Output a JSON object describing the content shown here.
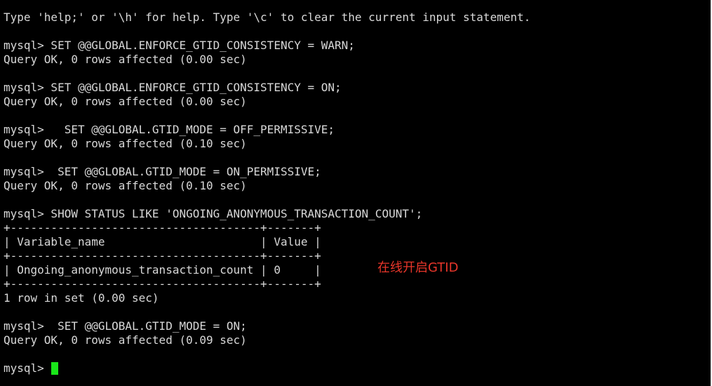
{
  "terminal": {
    "lines": [
      "Type 'help;' or '\\h' for help. Type '\\c' to clear the current input statement.",
      "",
      "mysql> SET @@GLOBAL.ENFORCE_GTID_CONSISTENCY = WARN;",
      "Query OK, 0 rows affected (0.00 sec)",
      "",
      "mysql> SET @@GLOBAL.ENFORCE_GTID_CONSISTENCY = ON;",
      "Query OK, 0 rows affected (0.00 sec)",
      "",
      "mysql>   SET @@GLOBAL.GTID_MODE = OFF_PERMISSIVE;",
      "Query OK, 0 rows affected (0.10 sec)",
      "",
      "mysql>  SET @@GLOBAL.GTID_MODE = ON_PERMISSIVE;",
      "Query OK, 0 rows affected (0.10 sec)",
      "",
      "mysql> SHOW STATUS LIKE 'ONGOING_ANONYMOUS_TRANSACTION_COUNT';",
      "+-------------------------------------+-------+",
      "| Variable_name                       | Value |",
      "+-------------------------------------+-------+",
      "| Ongoing_anonymous_transaction_count | 0     |",
      "+-------------------------------------+-------+",
      "1 row in set (0.00 sec)",
      "",
      "mysql>  SET @@GLOBAL.GTID_MODE = ON;",
      "Query OK, 0 rows affected (0.09 sec)",
      ""
    ],
    "prompt": "mysql> ",
    "cursor_color": "#19e619",
    "text_color": "#d8d8d8",
    "background": "#000000"
  },
  "annotation": {
    "text": "在线开启GTID",
    "color": "#e8362a"
  }
}
